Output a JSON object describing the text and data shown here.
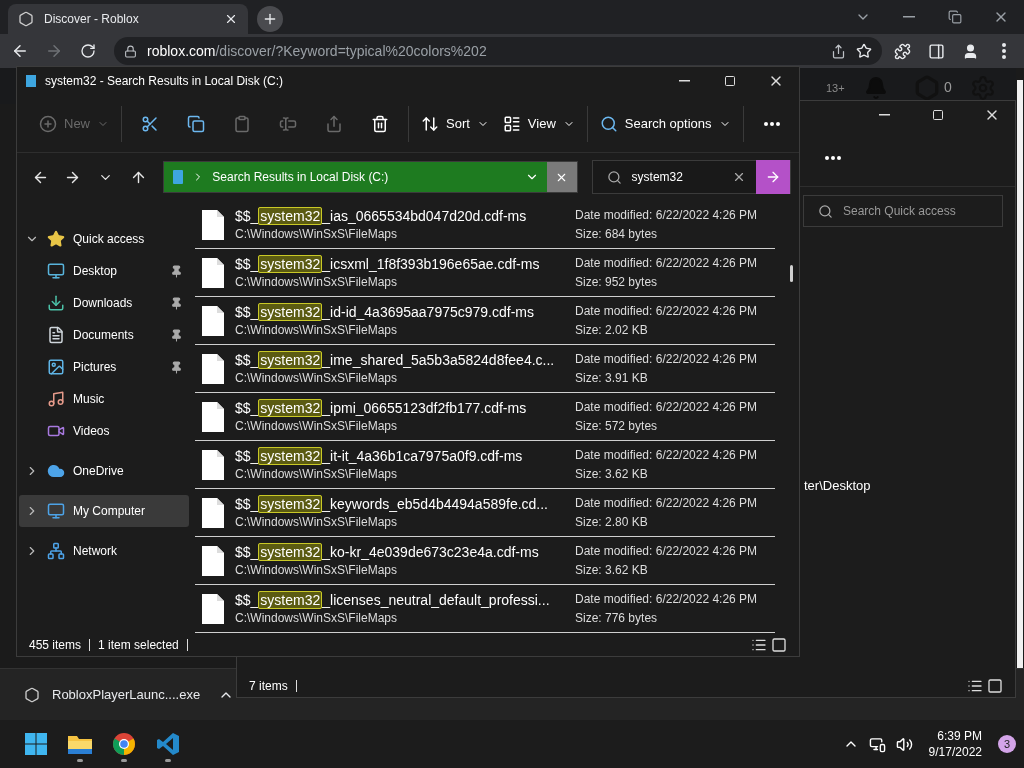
{
  "browser": {
    "tab_title": "Discover - Roblox",
    "url_host": "roblox.com",
    "url_path": "/discover/?Keyword=typical%20colors%202",
    "forward_enabled": false
  },
  "site_header": {
    "age_label": "13+",
    "robux": "0"
  },
  "back_window": {
    "search_placeholder": "Search Quick access",
    "path_fragment": "ter\\Desktop",
    "status": "7 items"
  },
  "explorer": {
    "title": "system32 - Search Results in Local Disk (C:)",
    "toolbar": [
      [
        {
          "kind": "new",
          "label": "New",
          "menu": true,
          "disabled": true
        }
      ],
      [
        {
          "kind": "cut",
          "disabled": false
        },
        {
          "kind": "copy",
          "disabled": false
        },
        {
          "kind": "paste",
          "disabled": true
        },
        {
          "kind": "rename",
          "disabled": true
        },
        {
          "kind": "share",
          "disabled": true
        },
        {
          "kind": "delete",
          "disabled": false
        }
      ],
      [
        {
          "kind": "sort",
          "label": "Sort",
          "menu": true,
          "disabled": false
        },
        {
          "kind": "view",
          "label": "View",
          "menu": true,
          "disabled": false
        }
      ],
      [
        {
          "kind": "search_options",
          "label": "Search options",
          "menu": true,
          "disabled": false
        }
      ],
      [
        {
          "kind": "more",
          "disabled": false
        }
      ]
    ],
    "address": "Search Results in Local Disk (C:)",
    "search": "system32",
    "sidebar": [
      {
        "kind": "star",
        "label": "Quick access",
        "expanded": true,
        "selected": false,
        "children": [
          {
            "kind": "desktop",
            "label": "Desktop",
            "pinned": true,
            "selected": false
          },
          {
            "kind": "downloads",
            "label": "Downloads",
            "pinned": true,
            "selected": false
          },
          {
            "kind": "documents",
            "label": "Documents",
            "pinned": true,
            "selected": false
          },
          {
            "kind": "pictures",
            "label": "Pictures",
            "pinned": true,
            "selected": false
          },
          {
            "kind": "music",
            "label": "Music",
            "pinned": false,
            "selected": false
          },
          {
            "kind": "videos",
            "label": "Videos",
            "pinned": false,
            "selected": false
          }
        ]
      },
      {
        "kind": "cloud",
        "label": "OneDrive",
        "expanded": false,
        "selected": false
      },
      {
        "kind": "computer",
        "label": "My Computer",
        "expanded": false,
        "selected": true
      },
      {
        "kind": "network",
        "label": "Network",
        "expanded": false,
        "selected": false
      }
    ],
    "files": [
      {
        "before": "$$_",
        "match": "system32",
        "after": "_ias_0665534bd047d20d.cdf-ms",
        "path": "C:\\Windows\\WinSxS\\FileMaps",
        "modified": "Date modified: 6/22/2022 4:26 PM",
        "size": "Size: 684 bytes"
      },
      {
        "before": "$$_",
        "match": "system32",
        "after": "_icsxml_1f8f393b196e65ae.cdf-ms",
        "path": "C:\\Windows\\WinSxS\\FileMaps",
        "modified": "Date modified: 6/22/2022 4:26 PM",
        "size": "Size: 952 bytes"
      },
      {
        "before": "$$_",
        "match": "system32",
        "after": "_id-id_4a3695aa7975c979.cdf-ms",
        "path": "C:\\Windows\\WinSxS\\FileMaps",
        "modified": "Date modified: 6/22/2022 4:26 PM",
        "size": "Size: 2.02 KB"
      },
      {
        "before": "$$_",
        "match": "system32",
        "after": "_ime_shared_5a5b3a5824d8fee4.c...",
        "path": "C:\\Windows\\WinSxS\\FileMaps",
        "modified": "Date modified: 6/22/2022 4:26 PM",
        "size": "Size: 3.91 KB"
      },
      {
        "before": "$$_",
        "match": "system32",
        "after": "_ipmi_06655123df2fb177.cdf-ms",
        "path": "C:\\Windows\\WinSxS\\FileMaps",
        "modified": "Date modified: 6/22/2022 4:26 PM",
        "size": "Size: 572 bytes"
      },
      {
        "before": "$$_",
        "match": "system32",
        "after": "_it-it_4a36b1ca7975a0f9.cdf-ms",
        "path": "C:\\Windows\\WinSxS\\FileMaps",
        "modified": "Date modified: 6/22/2022 4:26 PM",
        "size": "Size: 3.62 KB"
      },
      {
        "before": "$$_",
        "match": "system32",
        "after": "_keywords_eb5d4b4494a589fe.cd...",
        "path": "C:\\Windows\\WinSxS\\FileMaps",
        "modified": "Date modified: 6/22/2022 4:26 PM",
        "size": "Size: 2.80 KB"
      },
      {
        "before": "$$_",
        "match": "system32",
        "after": "_ko-kr_4e039de673c23e4a.cdf-ms",
        "path": "C:\\Windows\\WinSxS\\FileMaps",
        "modified": "Date modified: 6/22/2022 4:26 PM",
        "size": "Size: 3.62 KB"
      },
      {
        "before": "$$_",
        "match": "system32",
        "after": "_licenses_neutral_default_professi...",
        "path": "C:\\Windows\\WinSxS\\FileMaps",
        "modified": "Date modified: 6/22/2022 4:26 PM",
        "size": "Size: 776 bytes"
      }
    ],
    "status": {
      "count": "455 items",
      "selection": "1 item selected"
    }
  },
  "downloads": [
    {
      "name": "RobloxPlayerLaunc....exe"
    }
  ],
  "taskbar": {
    "apps": [
      {
        "kind": "start",
        "running": false
      },
      {
        "kind": "explorer",
        "running": true
      },
      {
        "kind": "chrome",
        "running": true
      },
      {
        "kind": "vscode",
        "running": true
      }
    ],
    "time": "6:39 PM",
    "date": "9/17/2022",
    "notifications": "3"
  }
}
